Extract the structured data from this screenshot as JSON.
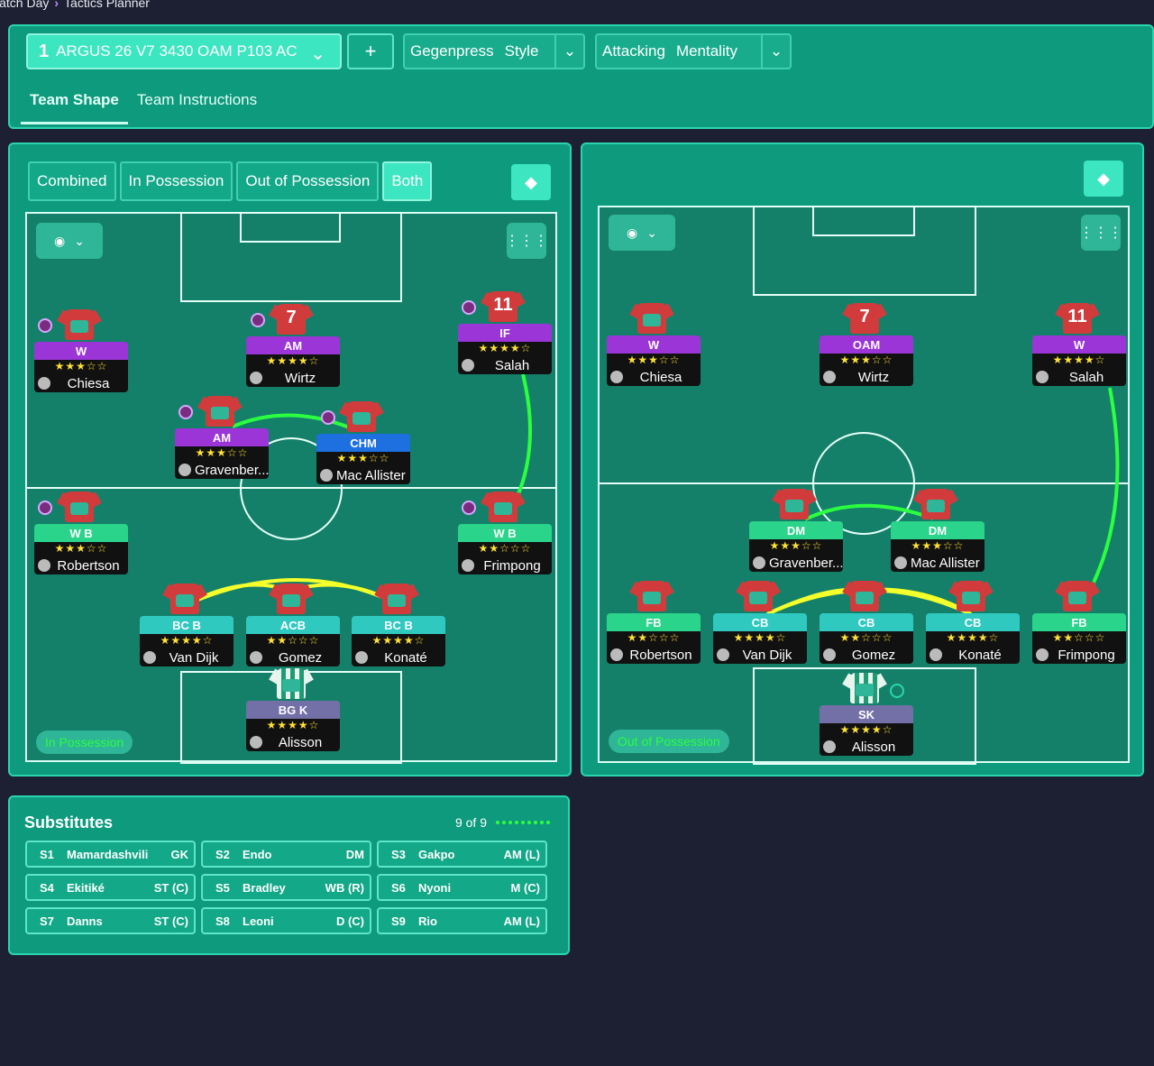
{
  "breadcrumb": {
    "parent": "latch Day",
    "current": "Tactics Planner"
  },
  "tactic": {
    "number": "1",
    "name": "ARGUS 26 V7 3430 OAM P103 AC"
  },
  "style": {
    "value": "Gegenpress",
    "label": "Style"
  },
  "mentality": {
    "value": "Attacking",
    "label": "Mentality"
  },
  "tabs": [
    "Team Shape",
    "Team Instructions"
  ],
  "view_modes": [
    "Combined",
    "In Possession",
    "Out of Possession",
    "Both"
  ],
  "left_pitch": {
    "phase": "In Possession",
    "players": [
      {
        "key": "chiesa",
        "role": "W",
        "stars": "★★★☆☆",
        "name": "Chiesa",
        "num": ""
      },
      {
        "key": "wirtz",
        "role": "AM",
        "stars": "★★★★☆",
        "name": "Wirtz",
        "num": "7"
      },
      {
        "key": "salah",
        "role": "IF",
        "stars": "★★★★☆",
        "name": "Salah",
        "num": "11"
      },
      {
        "key": "grav",
        "role": "AM",
        "stars": "★★★☆☆",
        "name": "Gravenber...",
        "num": ""
      },
      {
        "key": "macal",
        "role": "CHM",
        "stars": "★★★☆☆",
        "name": "Mac Allister",
        "num": ""
      },
      {
        "key": "rob",
        "role": "W B",
        "stars": "★★★☆☆",
        "name": "Robertson",
        "num": ""
      },
      {
        "key": "frim",
        "role": "W B",
        "stars": "★★☆☆☆",
        "name": "Frimpong",
        "num": ""
      },
      {
        "key": "vd",
        "role": "BC B",
        "stars": "★★★★☆",
        "name": "Van Dijk",
        "num": ""
      },
      {
        "key": "gomez",
        "role": "ACB",
        "stars": "★★☆☆☆",
        "name": "Gomez",
        "num": ""
      },
      {
        "key": "konate",
        "role": "BC B",
        "stars": "★★★★☆",
        "name": "Konaté",
        "num": ""
      },
      {
        "key": "alisson",
        "role": "BG K",
        "stars": "★★★★☆",
        "name": "Alisson",
        "num": ""
      }
    ]
  },
  "right_pitch": {
    "phase": "Out of Possession",
    "players": [
      {
        "key": "chiesa",
        "role": "W",
        "stars": "★★★☆☆",
        "name": "Chiesa",
        "num": ""
      },
      {
        "key": "wirtz",
        "role": "OAM",
        "stars": "★★★☆☆",
        "name": "Wirtz",
        "num": "7"
      },
      {
        "key": "salah",
        "role": "W",
        "stars": "★★★★☆",
        "name": "Salah",
        "num": "11"
      },
      {
        "key": "grav",
        "role": "DM",
        "stars": "★★★☆☆",
        "name": "Gravenber...",
        "num": ""
      },
      {
        "key": "macal",
        "role": "DM",
        "stars": "★★★☆☆",
        "name": "Mac Allister",
        "num": ""
      },
      {
        "key": "rob",
        "role": "FB",
        "stars": "★★☆☆☆",
        "name": "Robertson",
        "num": ""
      },
      {
        "key": "vd",
        "role": "CB",
        "stars": "★★★★☆",
        "name": "Van Dijk",
        "num": ""
      },
      {
        "key": "gomez",
        "role": "CB",
        "stars": "★★☆☆☆",
        "name": "Gomez",
        "num": ""
      },
      {
        "key": "konate",
        "role": "CB",
        "stars": "★★★★☆",
        "name": "Konaté",
        "num": ""
      },
      {
        "key": "frim",
        "role": "FB",
        "stars": "★★☆☆☆",
        "name": "Frimpong",
        "num": ""
      },
      {
        "key": "alisson",
        "role": "SK",
        "stars": "★★★★☆",
        "name": "Alisson",
        "num": ""
      }
    ]
  },
  "substitutes": {
    "title": "Substitutes",
    "count": "9 of 9",
    "items": [
      {
        "slot": "S1",
        "name": "Mamardashvili",
        "pos": "GK"
      },
      {
        "slot": "S2",
        "name": "Endo",
        "pos": "DM"
      },
      {
        "slot": "S3",
        "name": "Gakpo",
        "pos": "AM (L)"
      },
      {
        "slot": "S4",
        "name": "Ekitiké",
        "pos": "ST (C)"
      },
      {
        "slot": "S5",
        "name": "Bradley",
        "pos": "WB (R)"
      },
      {
        "slot": "S6",
        "name": "Nyoni",
        "pos": "M (C)"
      },
      {
        "slot": "S7",
        "name": "Danns",
        "pos": "ST (C)"
      },
      {
        "slot": "S8",
        "name": "Leoni",
        "pos": "D (C)"
      },
      {
        "slot": "S9",
        "name": "Rio",
        "pos": "AM (L)"
      }
    ]
  },
  "colors": {
    "panel": "#0e9a7d",
    "pitch": "#15806a",
    "attack_role": "#9b35d8",
    "mid_role": "#1e6fe0",
    "def_role": "#2ad48a",
    "cb_role": "#2fc9c0",
    "gk_role": "#7370a8",
    "link_green": "#2bff3f",
    "link_yellow": "#f4ff2b"
  }
}
